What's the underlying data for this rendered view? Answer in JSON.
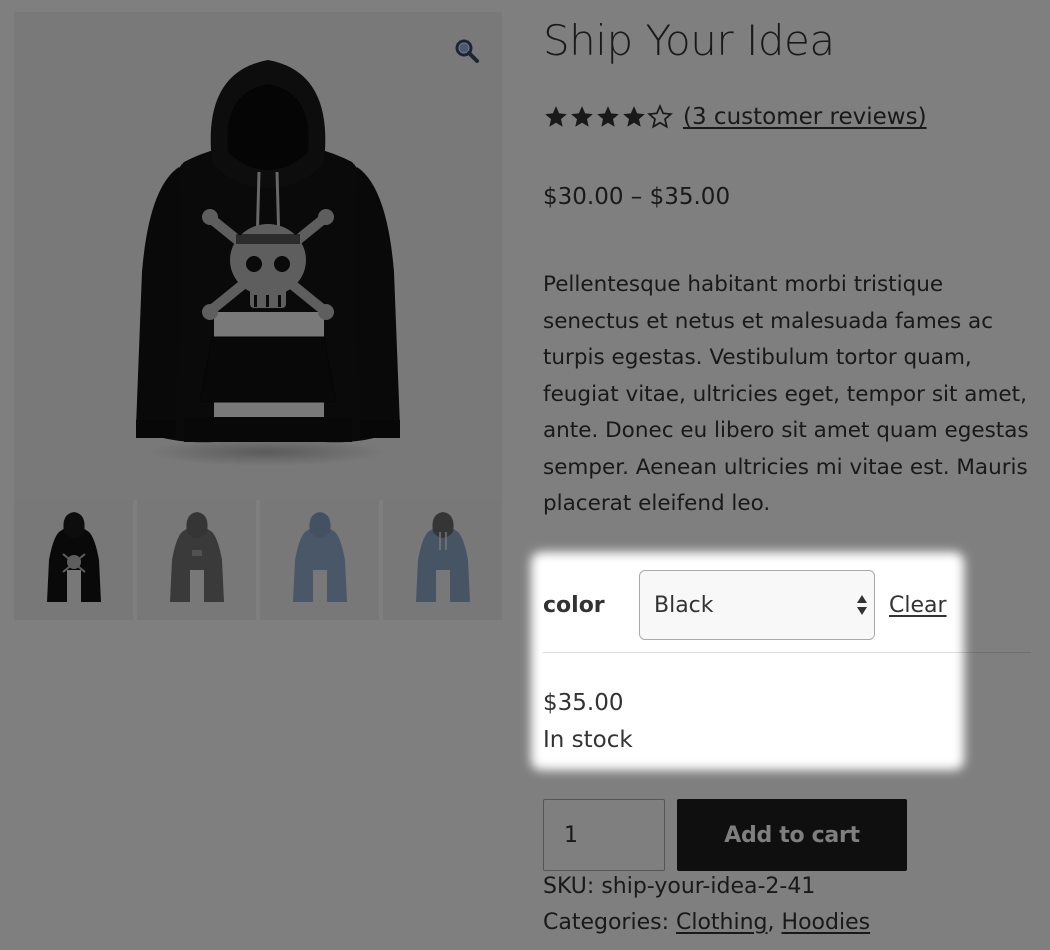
{
  "product": {
    "title": "Ship Your Idea",
    "rating_value": 4,
    "rating_max": 5,
    "review_link": "(3 customer reviews)",
    "price_range": "$30.00 – $35.00",
    "description": "Pellentesque habitant morbi tristique senectus et netus et malesuada fames ac turpis egestas. Vestibulum tortor quam, feugiat vitae, ultricies eget, tempor sit amet, ante. Donec eu libero sit amet quam egestas semper. Aenean ultricies mi vitae est. Mauris placerat eleifend leo."
  },
  "gallery": {
    "zoom_icon": "magnifier-icon",
    "thumbnail_colors": [
      "black",
      "gray",
      "blue",
      "blue-gray"
    ]
  },
  "variations": {
    "label": "color",
    "selected": "Black",
    "clear_label": "Clear",
    "variation_price": "$35.00",
    "stock_status": "In stock"
  },
  "cart": {
    "quantity": "1",
    "add_to_cart_label": "Add to cart"
  },
  "meta": {
    "sku_label": "SKU:",
    "sku_value": "ship-your-idea-2-41",
    "categories_label": "Categories:",
    "category_1": "Clothing",
    "category_separator": ",",
    "category_2": "Hoodies"
  },
  "colors": {
    "text": "#333333",
    "button_bg": "#1f1f1f",
    "overlay": "rgba(0,0,0,0.5)",
    "star": "#333333"
  }
}
